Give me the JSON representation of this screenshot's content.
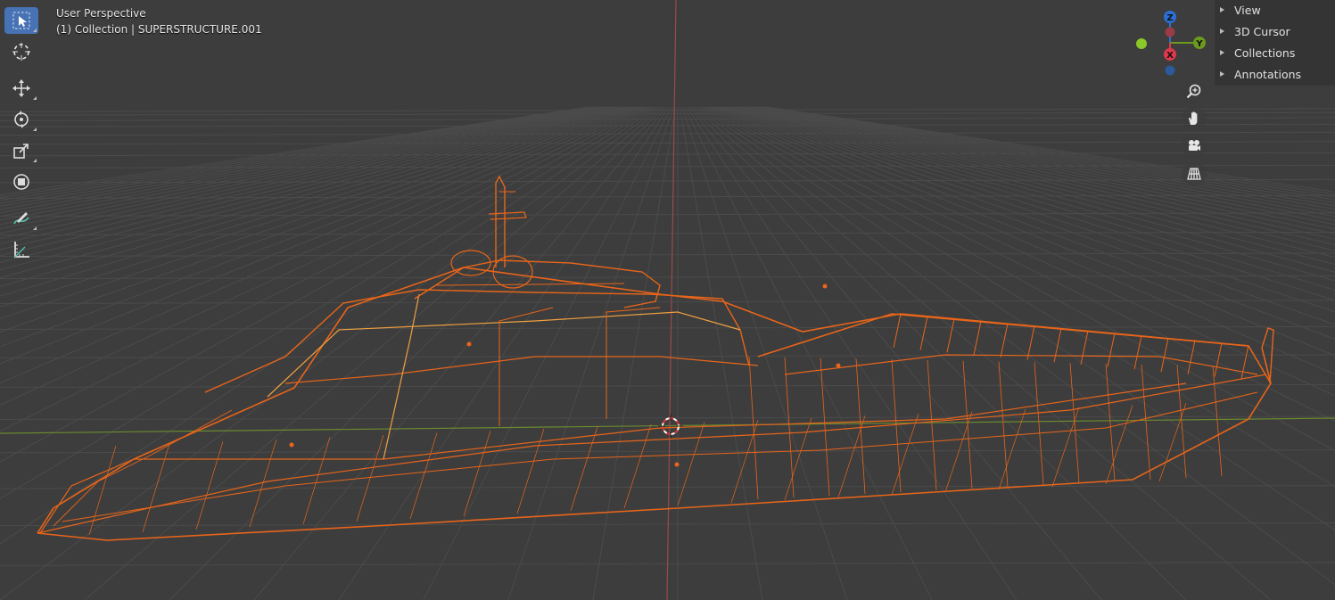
{
  "viewport": {
    "view_name": "User Perspective",
    "collection_info": "(1) Collection | SUPERSTRUCTURE.001",
    "background_color": "#3d3d3d",
    "grid_color": "#4b4b4b",
    "x_axis_color": "#9a4a4a",
    "y_axis_color": "#6a8a2e",
    "object_color": "#e8651a",
    "selected_highlight_color": "#f0a040"
  },
  "toolbar": {
    "tools": [
      {
        "name": "select-box-tool",
        "icon": "select-box-icon",
        "active": true
      },
      {
        "name": "cursor-tool",
        "icon": "cursor-icon",
        "active": false
      },
      {
        "name": "move-tool",
        "icon": "move-icon",
        "active": false
      },
      {
        "name": "rotate-tool",
        "icon": "rotate-icon",
        "active": false
      },
      {
        "name": "scale-tool",
        "icon": "scale-icon",
        "active": false
      },
      {
        "name": "transform-tool",
        "icon": "transform-icon",
        "active": false
      },
      {
        "name": "annotate-tool",
        "icon": "annotate-icon",
        "active": false
      },
      {
        "name": "measure-tool",
        "icon": "measure-icon",
        "active": false
      }
    ]
  },
  "sidebar": {
    "items": [
      {
        "label": "View"
      },
      {
        "label": "3D Cursor"
      },
      {
        "label": "Collections"
      },
      {
        "label": "Annotations"
      }
    ]
  },
  "gizmo": {
    "axes": [
      {
        "label": "Z",
        "color": "#2c6fd6"
      },
      {
        "label": "Y",
        "color": "#6b9a1e"
      },
      {
        "label": "X",
        "color": "#e0384b"
      }
    ],
    "neg_colors": {
      "z": "#2b5a9a",
      "y": "#8ac728",
      "x": "#9a3b47"
    }
  },
  "nav_controls": [
    {
      "name": "zoom-button",
      "icon": "zoom-icon"
    },
    {
      "name": "pan-button",
      "icon": "hand-icon"
    },
    {
      "name": "camera-button",
      "icon": "camera-icon"
    },
    {
      "name": "perspective-toggle-button",
      "icon": "grid-icon"
    }
  ]
}
